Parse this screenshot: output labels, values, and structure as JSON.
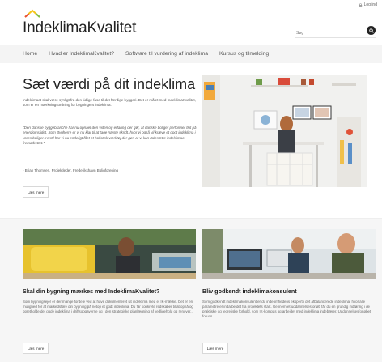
{
  "topbar": {
    "login_label": "Log ind"
  },
  "header": {
    "logo_text": "IndeklimaKvalitet",
    "search_placeholder": "Søg"
  },
  "nav": {
    "items": [
      {
        "label": "Home"
      },
      {
        "label": "Hvad er IndeklimaKvalitet?"
      },
      {
        "label": "Software til vurdering af indeklima"
      },
      {
        "label": "Kursus og tilmelding"
      }
    ]
  },
  "hero": {
    "title": "Sæt værdi på dit indeklima",
    "paragraph": "Indeklimaet skal være synligt fra den tidlige fase til det færdige byggeri. Det er målet med IndeklimaKvalitet, som er en mærkningsordning for bygningers indeklima.",
    "quote": "\"Den danske byggebranche har nu opnået den viden og erfaring der gør, at danske boliger performer flot på energiområdet. Som Bygherre er vi nu klar til at tage næste skridt, hvor vi også vil kræve et godt indeklima i vores boliger. Hertil har vi nu endeligt fået et holistisk værktøj der gør, at vi kan italesætte indeklimaet fremadrettet.\"",
    "author": "- Brian Thomsen, Projektleder, Frederikshavn Boligforening",
    "button_label": "Læs mere"
  },
  "cards": [
    {
      "title": "Skal din bygning mærkes med IndeklimaKvalitet?",
      "text": "Som bygningsejer er der mange fordele ved at have dokumenteret sit indeklima med et IK-mærke. Det er en mulighed for at markedsføre din bygning på netop et godt indeklima. Du får konkrete redskaber til at opnå og opretholde det gode indeklima i driftsopgaverne og i den strategiske planlægning af vedligehold og renover...",
      "button_label": "Læs mere"
    },
    {
      "title": "Bliv godkendt indeklimakonsulent",
      "text": "Som godkendt indeklimakonsulent er du indeomhedens ekspert i det afbalancerede indeklima, hvor alle parametre er indarbejdet fra projektets start. Gennem et uddannelsesforløb får du en grundig indføring i de praktiske og teoretiske forhold, som IK-kompas og arbejdet med indeklima indebærer. Uddannelsesforløbet foruds...",
      "button_label": "Læs mere"
    }
  ],
  "colors": {
    "logo_red": "#e8503a",
    "logo_yellow": "#f5c518",
    "logo_green": "#7fbf4a",
    "nav_bg": "#f4f4f4",
    "cards_bg": "#f6f6f6"
  },
  "icons": {
    "login": "lock-icon",
    "search": "search-icon",
    "logo": "roof-chevron-logo"
  }
}
